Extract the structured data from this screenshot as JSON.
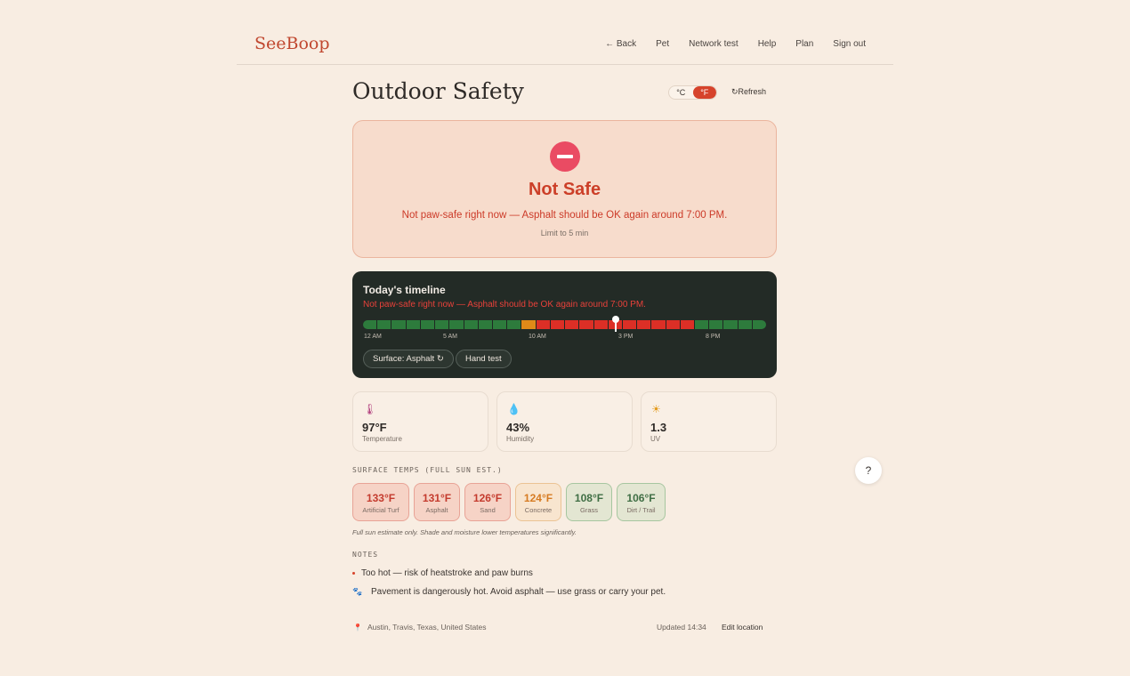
{
  "brand": "SeeBoop",
  "nav": [
    "← Back",
    "Pet",
    "Network test",
    "Help",
    "Plan",
    "Sign out"
  ],
  "page_title": "Outdoor Safety",
  "units": {
    "celsius": "°C",
    "fahrenheit": "°F",
    "selected": "°F"
  },
  "refresh_label": "↻Refresh",
  "status": {
    "title": "Not Safe",
    "message": "Not paw-safe right now — Asphalt should be OK again around 7:00 PM.",
    "limit": "Limit to 5 min",
    "icon": "no-entry-icon",
    "color": "#cc3f28"
  },
  "timeline": {
    "title": "Today's timeline",
    "message": "Not paw-safe right now — Asphalt should be OK again around 7:00 PM.",
    "ticks": [
      "12 AM",
      "5 AM",
      "10 AM",
      "3 PM",
      "8 PM"
    ],
    "segments": [
      "safe",
      "safe",
      "safe",
      "safe",
      "safe",
      "safe",
      "safe",
      "safe",
      "safe",
      "safe",
      "safe",
      "caution",
      "danger",
      "danger",
      "danger",
      "danger",
      "danger",
      "danger",
      "danger",
      "danger",
      "danger",
      "danger",
      "danger",
      "safe",
      "safe",
      "safe",
      "safe",
      "safe"
    ],
    "colors": {
      "safe": "#2d7b3c",
      "caution": "#e08a18",
      "danger": "#dc2f26"
    },
    "current_hour": 15,
    "surface_chip": "Surface: Asphalt ↻",
    "hand_test_chip": "Hand test"
  },
  "metrics": [
    {
      "icon": "thermometer-icon",
      "value": "97°F",
      "label": "Temperature"
    },
    {
      "icon": "droplet-icon",
      "value": "43%",
      "label": "Humidity"
    },
    {
      "icon": "sun-icon",
      "value": "1.3",
      "label": "UV"
    }
  ],
  "surfaces_label": "SURFACE TEMPS (FULL SUN EST.)",
  "surfaces": [
    {
      "value": "133°F",
      "name": "Artificial Turf",
      "level": "hot"
    },
    {
      "value": "131°F",
      "name": "Asphalt",
      "level": "hot"
    },
    {
      "value": "126°F",
      "name": "Sand",
      "level": "hot"
    },
    {
      "value": "124°F",
      "name": "Concrete",
      "level": "warm"
    },
    {
      "value": "108°F",
      "name": "Grass",
      "level": "cool"
    },
    {
      "value": "106°F",
      "name": "Dirt / Trail",
      "level": "cool"
    }
  ],
  "surfaces_footnote": "Full sun estimate only. Shade and moisture lower temperatures significantly.",
  "notes_label": "NOTES",
  "notes": [
    "Too hot — risk of heatstroke and paw burns",
    "Pavement is dangerously hot. Avoid asphalt — use grass or carry your pet."
  ],
  "footer": {
    "location": "Austin, Travis, Texas, United States",
    "updated": "Updated 14:34",
    "edit_location": "Edit location"
  }
}
